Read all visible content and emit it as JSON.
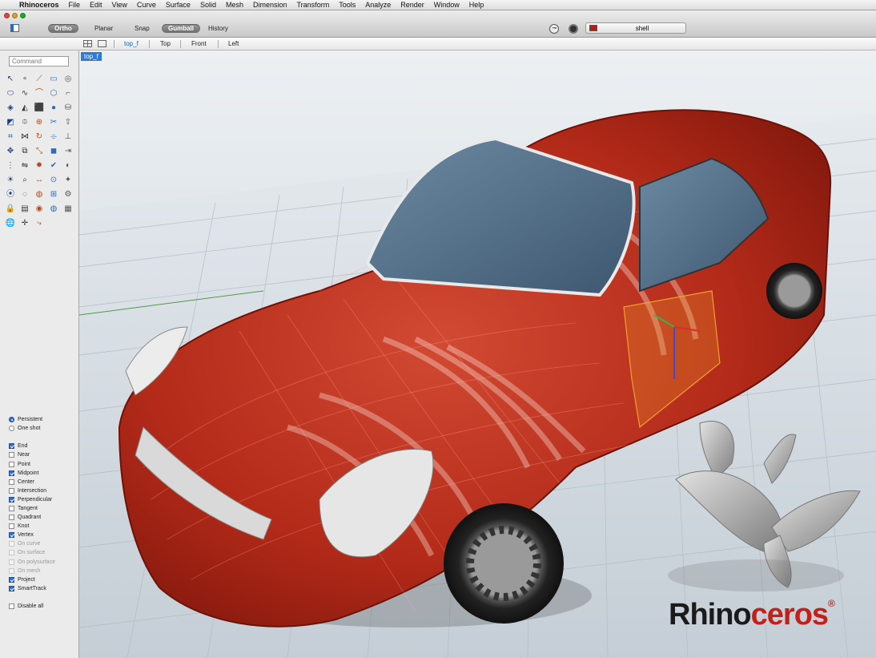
{
  "menubar": {
    "apple_icon": "apple-icon",
    "items": [
      "Rhinoceros",
      "File",
      "Edit",
      "View",
      "Curve",
      "Surface",
      "Solid",
      "Mesh",
      "Dimension",
      "Transform",
      "Tools",
      "Analyze",
      "Render",
      "Window",
      "Help"
    ]
  },
  "toolbar": {
    "ortho": "Ortho",
    "planar": "Planar",
    "snap": "Snap",
    "gumball": "Gumball",
    "history": "History",
    "layer_name": "shell",
    "layer_color": "#b31d14"
  },
  "view_tabs": {
    "named_view": "top_f",
    "top": "Top",
    "front": "Front",
    "left": "Left"
  },
  "command_placeholder": "Command",
  "viewport_label": "top_f",
  "osnaps": [
    {
      "label": "Persistent",
      "type": "radio",
      "checked": true,
      "enabled": true
    },
    {
      "label": "One shot",
      "type": "radio",
      "checked": false,
      "enabled": true
    },
    {
      "label": "",
      "type": "spacer"
    },
    {
      "label": "End",
      "type": "check",
      "checked": true,
      "enabled": true
    },
    {
      "label": "Near",
      "type": "check",
      "checked": false,
      "enabled": true
    },
    {
      "label": "Point",
      "type": "check",
      "checked": false,
      "enabled": true
    },
    {
      "label": "Midpoint",
      "type": "check",
      "checked": true,
      "enabled": true
    },
    {
      "label": "Center",
      "type": "check",
      "checked": false,
      "enabled": true
    },
    {
      "label": "Intersection",
      "type": "check",
      "checked": false,
      "enabled": true
    },
    {
      "label": "Perpendicular",
      "type": "check",
      "checked": true,
      "enabled": true
    },
    {
      "label": "Tangent",
      "type": "check",
      "checked": false,
      "enabled": true
    },
    {
      "label": "Quadrant",
      "type": "check",
      "checked": false,
      "enabled": true
    },
    {
      "label": "Knot",
      "type": "check",
      "checked": false,
      "enabled": true
    },
    {
      "label": "Vertex",
      "type": "check",
      "checked": true,
      "enabled": true
    },
    {
      "label": "On curve",
      "type": "check",
      "checked": false,
      "enabled": false
    },
    {
      "label": "On surface",
      "type": "check",
      "checked": false,
      "enabled": false
    },
    {
      "label": "On polysurface",
      "type": "check",
      "checked": false,
      "enabled": false
    },
    {
      "label": "On mesh",
      "type": "check",
      "checked": false,
      "enabled": false
    },
    {
      "label": "Project",
      "type": "check",
      "checked": true,
      "enabled": true
    },
    {
      "label": "SmartTrack",
      "type": "check",
      "checked": true,
      "enabled": true
    },
    {
      "label": "",
      "type": "spacer"
    },
    {
      "label": "Disable all",
      "type": "check",
      "checked": false,
      "enabled": true
    }
  ],
  "tools": [
    {
      "icon": "select-arrow-icon",
      "glyph": "↖"
    },
    {
      "icon": "point-icon",
      "glyph": "∘"
    },
    {
      "icon": "polyline-icon",
      "glyph": "⟋"
    },
    {
      "icon": "rectangle-icon",
      "glyph": "▭"
    },
    {
      "icon": "circle-icon",
      "glyph": "◎"
    },
    {
      "icon": "ellipse-icon",
      "glyph": "⬭"
    },
    {
      "icon": "curve-icon",
      "glyph": "∿"
    },
    {
      "icon": "arc-icon",
      "glyph": "⌒"
    },
    {
      "icon": "polygon-icon",
      "glyph": "⬡"
    },
    {
      "icon": "fillet-curve-icon",
      "glyph": "⌐"
    },
    {
      "icon": "surface-icon",
      "glyph": "◈"
    },
    {
      "icon": "sweep-icon",
      "glyph": "◭"
    },
    {
      "icon": "box-icon",
      "glyph": "⬛"
    },
    {
      "icon": "sphere-icon",
      "glyph": "●"
    },
    {
      "icon": "cylinder-icon",
      "glyph": "⛁"
    },
    {
      "icon": "loft-icon",
      "glyph": "◩"
    },
    {
      "icon": "network-icon",
      "glyph": "⯐"
    },
    {
      "icon": "boolean-icon",
      "glyph": "⊕"
    },
    {
      "icon": "split-icon",
      "glyph": "✂"
    },
    {
      "icon": "extrude-icon",
      "glyph": "⇧"
    },
    {
      "icon": "mesh-icon",
      "glyph": "⌗"
    },
    {
      "icon": "join-icon",
      "glyph": "⋈"
    },
    {
      "icon": "rotate-icon",
      "glyph": "↻"
    },
    {
      "icon": "trim-icon",
      "glyph": "⌯"
    },
    {
      "icon": "dimension-icon",
      "glyph": "⊥"
    },
    {
      "icon": "move-icon",
      "glyph": "✥"
    },
    {
      "icon": "copy-icon",
      "glyph": "⧉"
    },
    {
      "icon": "scale-icon",
      "glyph": "⤡"
    },
    {
      "icon": "solid-box-icon",
      "glyph": "◼"
    },
    {
      "icon": "offset-icon",
      "glyph": "⇥"
    },
    {
      "icon": "array-icon",
      "glyph": "⋮"
    },
    {
      "icon": "mirror-icon",
      "glyph": "⇋"
    },
    {
      "icon": "explode-icon",
      "glyph": "✸"
    },
    {
      "icon": "check-icon",
      "glyph": "✔"
    },
    {
      "icon": "analyze-icon",
      "glyph": "◐"
    },
    {
      "icon": "render-icon",
      "glyph": "☀"
    },
    {
      "icon": "zoom-icon",
      "glyph": "⌕"
    },
    {
      "icon": "distance-icon",
      "glyph": "↔"
    },
    {
      "icon": "curvature-icon",
      "glyph": "⊙"
    },
    {
      "icon": "light-icon",
      "glyph": "✦"
    },
    {
      "icon": "camera-icon",
      "glyph": "⦿"
    },
    {
      "icon": "hide-icon",
      "glyph": "◌"
    },
    {
      "icon": "color-wheel-icon",
      "glyph": "◍"
    },
    {
      "icon": "grid-icon",
      "glyph": "⊞"
    },
    {
      "icon": "settings-icon",
      "glyph": "⚙"
    },
    {
      "icon": "lock-icon",
      "glyph": "🔒"
    },
    {
      "icon": "layer-icon",
      "glyph": "▤"
    },
    {
      "icon": "material-icon",
      "glyph": "◉"
    },
    {
      "icon": "environment-icon",
      "glyph": "◍"
    },
    {
      "icon": "snapshot-icon",
      "glyph": "▦"
    },
    {
      "icon": "globe-icon",
      "glyph": "🌐"
    },
    {
      "icon": "gumball-icon",
      "glyph": "✛"
    },
    {
      "icon": "history-icon",
      "glyph": "⤷"
    }
  ],
  "logo": {
    "part1": "Rhino",
    "part2": "ceros",
    "mark": "®"
  },
  "colors": {
    "car_body": "#b72a1a",
    "logo_red": "#c4201a",
    "active_tab": "#1d5fc0",
    "viewport_badge": "#2e7ad6"
  }
}
